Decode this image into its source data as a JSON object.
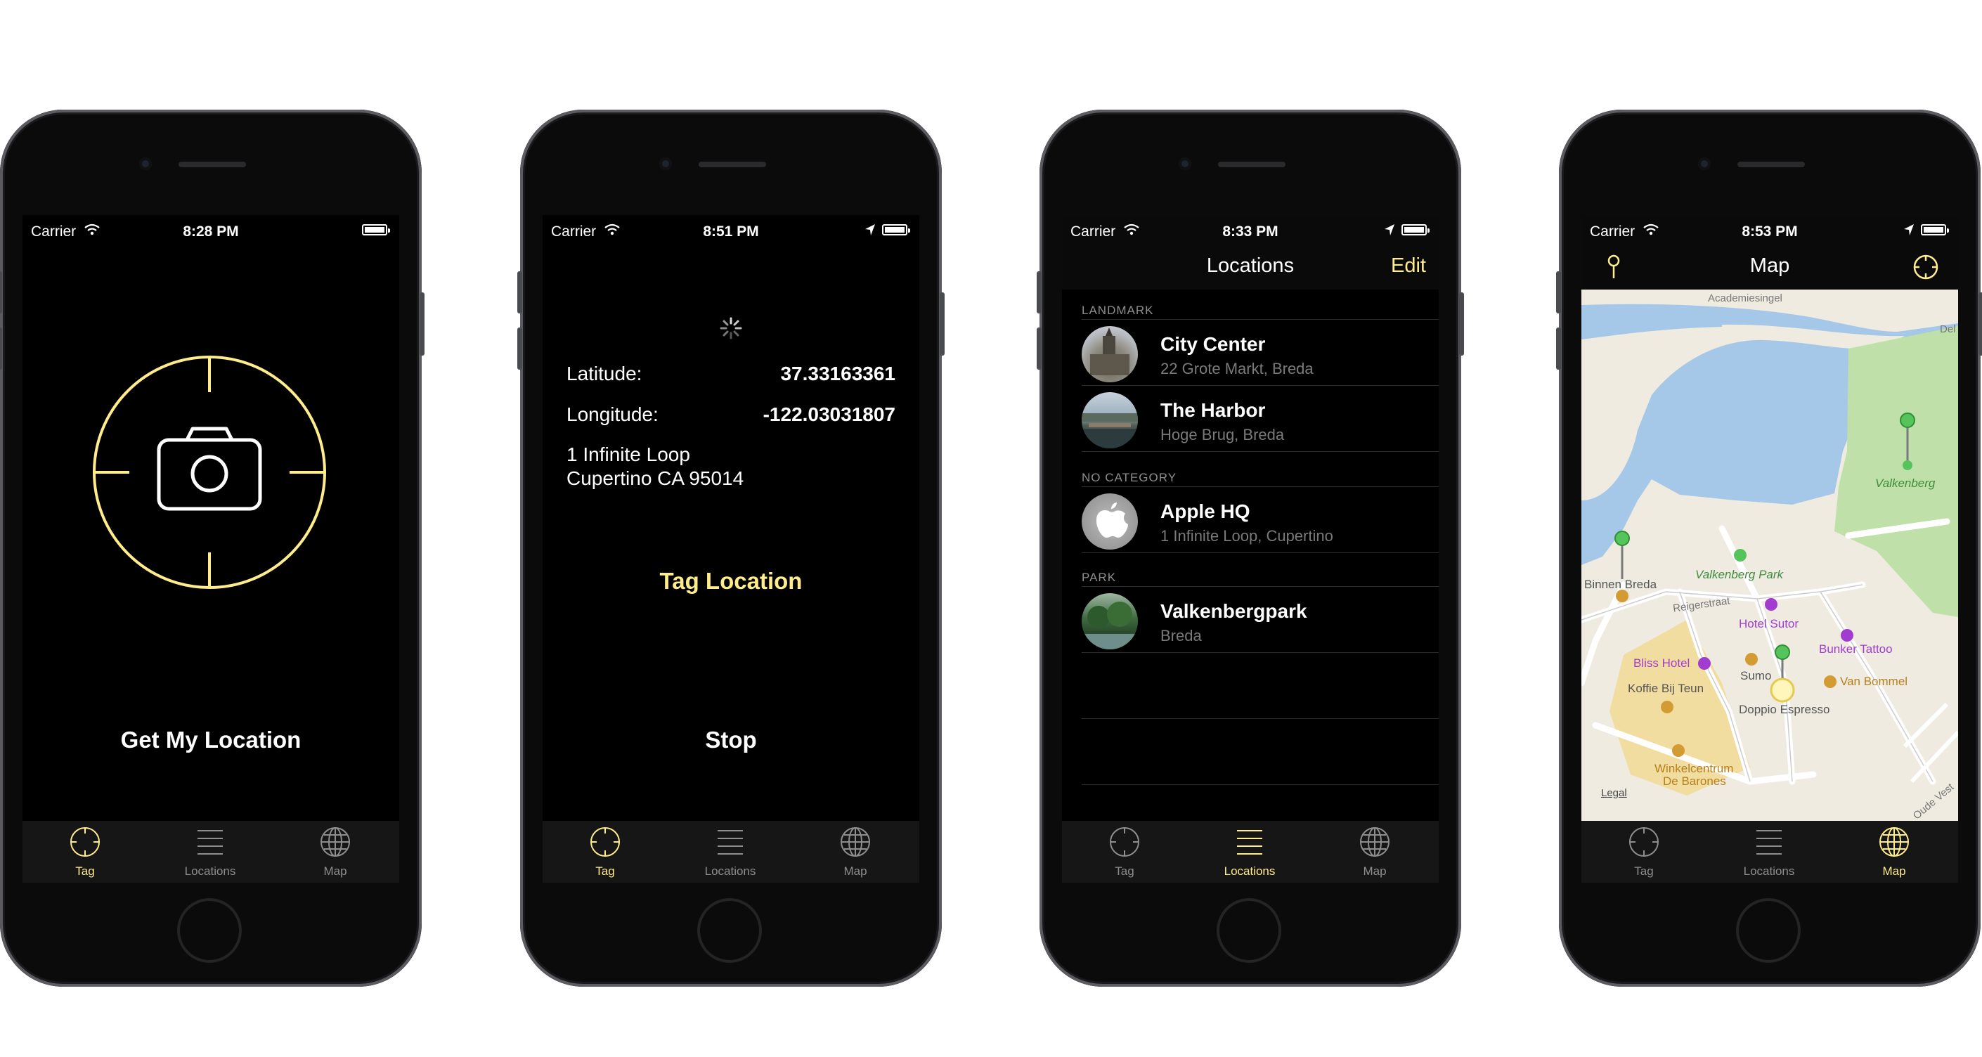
{
  "status": {
    "carrier": "Carrier",
    "times": [
      "8:28 PM",
      "8:51 PM",
      "8:33 PM",
      "8:53 PM"
    ]
  },
  "tabs": {
    "tag": "Tag",
    "locations": "Locations",
    "map": "Map"
  },
  "colors": {
    "accent": "#ffec8b",
    "background": "#000000",
    "tabbar": "#161616",
    "inactive": "#8e8e8e"
  },
  "phone1": {
    "get_location_button": "Get My Location"
  },
  "phone2": {
    "latitude_label": "Latitude:",
    "latitude_value": "37.33163361",
    "longitude_label": "Longitude:",
    "longitude_value": "-122.03031807",
    "address_line1": "1 Infinite Loop",
    "address_line2": "Cupertino CA 95014",
    "tag_location_button": "Tag Location",
    "stop_button": "Stop"
  },
  "phone3": {
    "title": "Locations",
    "edit_button": "Edit",
    "sections": [
      {
        "header": "LANDMARK",
        "rows": [
          {
            "title": "City Center",
            "subtitle": "22 Grote Markt, Breda"
          },
          {
            "title": "The Harbor",
            "subtitle": "Hoge Brug, Breda"
          }
        ]
      },
      {
        "header": "NO CATEGORY",
        "rows": [
          {
            "title": "Apple HQ",
            "subtitle": "1 Infinite Loop, Cupertino"
          }
        ]
      },
      {
        "header": "PARK",
        "rows": [
          {
            "title": "Valkenbergpark",
            "subtitle": "Breda"
          }
        ]
      }
    ]
  },
  "phone4": {
    "title": "Map",
    "labels": {
      "academiesingel": "Academiesingel",
      "del": "Del",
      "valkenberg": "Valkenberg",
      "valkenberg_park": "Valkenberg Park",
      "binnen_breda": "Binnen Breda",
      "reigerstraat": "Reigerstraat",
      "hotel_sutor": "Hotel Sutor",
      "bliss_hotel": "Bliss Hotel",
      "bunker_tattoo": "Bunker Tattoo",
      "sumo": "Sumo",
      "van_bommel": "Van Bommel",
      "koffie_bij_teun": "Koffie Bij Teun",
      "doppio_espresso": "Doppio Espresso",
      "winkelcentrum": "Winkelcentrum",
      "de_barones": "De Barones",
      "legal": "Legal",
      "oude_vest": "Oude Vest"
    }
  }
}
